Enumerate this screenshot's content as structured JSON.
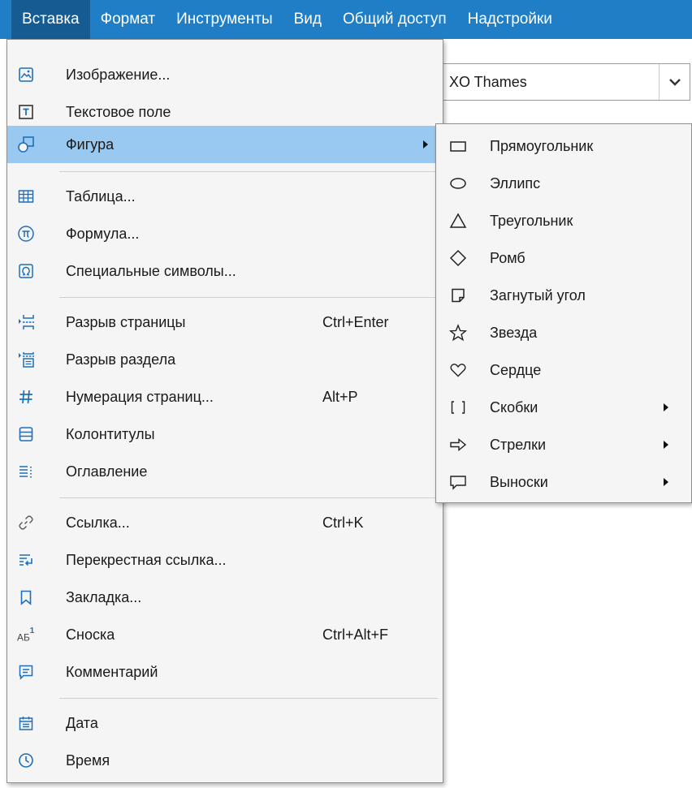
{
  "menubar": {
    "items": [
      {
        "label": "Вставка"
      },
      {
        "label": "Формат"
      },
      {
        "label": "Инструменты"
      },
      {
        "label": "Вид"
      },
      {
        "label": "Общий доступ"
      },
      {
        "label": "Надстройки"
      }
    ],
    "active_index": 0
  },
  "background": {
    "font_select_value": "XO Thames"
  },
  "insert_menu": {
    "items": [
      {
        "label": "Изображение...",
        "icon": "image-icon"
      },
      {
        "label": "Текстовое поле",
        "icon": "text-box-icon"
      },
      {
        "label": "Фигура",
        "icon": "shapes-icon",
        "submenu": true,
        "highlighted": true
      },
      {
        "label": "Таблица...",
        "icon": "table-icon"
      },
      {
        "label": "Формула...",
        "icon": "formula-icon"
      },
      {
        "label": "Специальные символы...",
        "icon": "omega-icon"
      },
      {
        "label": "Разрыв страницы",
        "icon": "page-break-icon",
        "shortcut": "Ctrl+Enter"
      },
      {
        "label": "Разрыв раздела",
        "icon": "section-break-icon"
      },
      {
        "label": "Нумерация страниц...",
        "icon": "hash-icon",
        "shortcut": "Alt+P"
      },
      {
        "label": "Колонтитулы",
        "icon": "header-footer-icon"
      },
      {
        "label": "Оглавление",
        "icon": "toc-icon"
      },
      {
        "label": "Ссылка...",
        "icon": "link-icon",
        "shortcut": "Ctrl+K"
      },
      {
        "label": "Перекрестная ссылка...",
        "icon": "cross-reference-icon"
      },
      {
        "label": "Закладка...",
        "icon": "bookmark-icon"
      },
      {
        "label": "Сноска",
        "icon": "footnote-icon",
        "shortcut": "Ctrl+Alt+F"
      },
      {
        "label": "Комментарий",
        "icon": "comment-icon"
      },
      {
        "label": "Дата",
        "icon": "calendar-icon"
      },
      {
        "label": "Время",
        "icon": "clock-icon"
      }
    ]
  },
  "shape_menu": {
    "items": [
      {
        "label": "Прямоугольник",
        "icon": "rectangle-icon"
      },
      {
        "label": "Эллипс",
        "icon": "ellipse-icon"
      },
      {
        "label": "Треугольник",
        "icon": "triangle-icon"
      },
      {
        "label": "Ромб",
        "icon": "rhombus-icon"
      },
      {
        "label": "Загнутый угол",
        "icon": "folded-corner-icon"
      },
      {
        "label": "Звезда",
        "icon": "star-icon"
      },
      {
        "label": "Сердце",
        "icon": "heart-icon"
      },
      {
        "label": "Скобки",
        "icon": "brackets-icon",
        "submenu": true
      },
      {
        "label": "Стрелки",
        "icon": "arrow-icon",
        "submenu": true
      },
      {
        "label": "Выноски",
        "icon": "callout-icon",
        "submenu": true
      }
    ]
  },
  "colors": {
    "menubar": "#1f7ec6",
    "menubar_active": "#165c92",
    "highlight": "#99c8f0",
    "menu_bg": "#f5f5f5",
    "icon_blue": "#1f6fb8"
  }
}
